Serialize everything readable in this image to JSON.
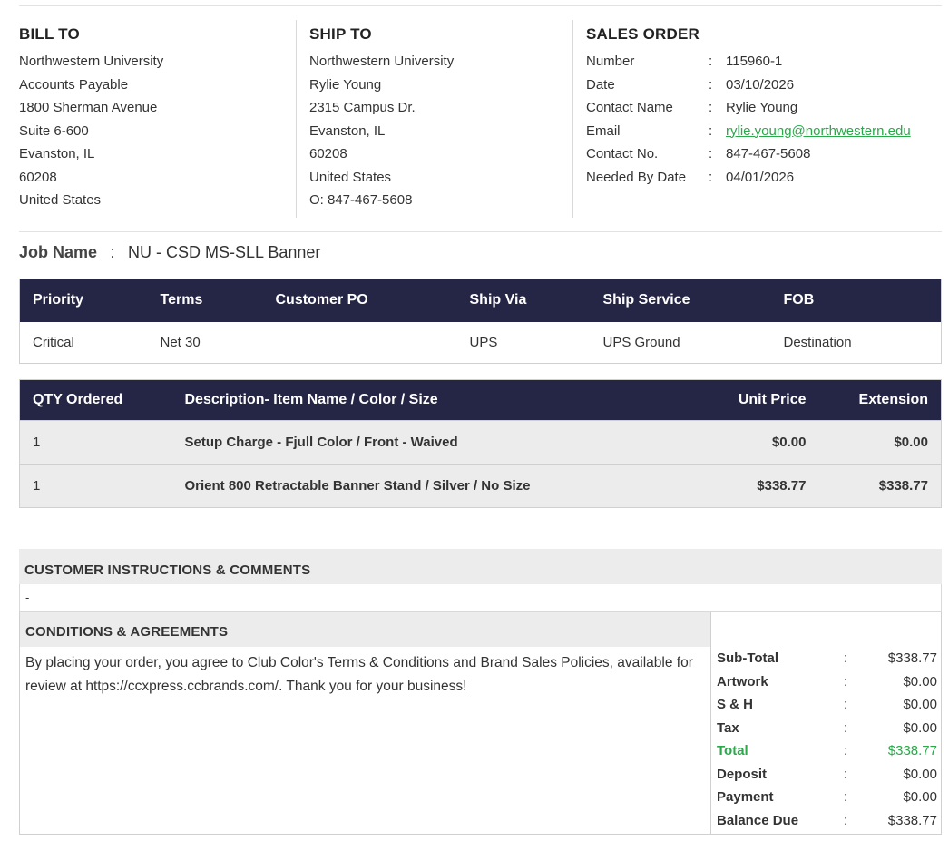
{
  "bill_to": {
    "heading": "BILL TO",
    "lines": [
      "Northwestern University",
      "Accounts Payable",
      "1800 Sherman Avenue",
      "Suite 6-600",
      "Evanston, IL",
      "60208",
      "United States"
    ]
  },
  "ship_to": {
    "heading": "SHIP TO",
    "lines": [
      "Northwestern University",
      "Rylie Young",
      "2315 Campus Dr.",
      "Evanston, IL",
      "60208",
      "United States",
      "O: 847-467-5608"
    ]
  },
  "sales_order": {
    "heading": "SALES ORDER",
    "rows": [
      {
        "label": "Number",
        "value": "115960-1"
      },
      {
        "label": "Date",
        "value": "03/10/2026"
      },
      {
        "label": "Contact Name",
        "value": "Rylie Young"
      },
      {
        "label": "Email",
        "value": "rylie.young@northwestern.edu"
      },
      {
        "label": "Contact No.",
        "value": "847-467-5608"
      },
      {
        "label": "Needed By Date",
        "value": "04/01/2026"
      }
    ]
  },
  "job": {
    "label": "Job Name",
    "value": "NU - CSD MS-SLL Banner"
  },
  "info_table": {
    "headers": [
      "Priority",
      "Terms",
      "Customer PO",
      "Ship Via",
      "Ship Service",
      "FOB"
    ],
    "row": [
      "Critical",
      "Net 30",
      "",
      "UPS",
      "UPS Ground",
      "Destination"
    ]
  },
  "items_table": {
    "headers": [
      "QTY Ordered",
      "Description- Item Name / Color / Size",
      "Unit Price",
      "Extension"
    ],
    "rows": [
      [
        "1",
        "Setup Charge - Fjull Color / Front - Waived",
        "$0.00",
        "$0.00"
      ],
      [
        "1",
        "Orient 800 Retractable Banner Stand / Silver / No Size",
        "$338.77",
        "$338.77"
      ]
    ]
  },
  "customer_instructions": {
    "heading": "CUSTOMER INSTRUCTIONS & COMMENTS",
    "text": "-"
  },
  "conditions": {
    "heading": "CONDITIONS & AGREEMENTS",
    "text": "By placing your order, you agree to Club Color's Terms & Conditions and Brand Sales Policies, available for review at https://ccxpress.ccbrands.com/. Thank you for your business!"
  },
  "totals": [
    {
      "label": "Sub-Total",
      "value": "$338.77"
    },
    {
      "label": "Artwork",
      "value": "$0.00"
    },
    {
      "label": "S & H",
      "value": "$0.00"
    },
    {
      "label": "Tax",
      "value": "$0.00"
    },
    {
      "label": "Total",
      "value": "$338.77"
    },
    {
      "label": "Deposit",
      "value": "$0.00"
    },
    {
      "label": "Payment",
      "value": "$0.00"
    },
    {
      "label": "Balance Due",
      "value": "$338.77"
    }
  ],
  "colors": {
    "header_bg": "#252545",
    "accent_green": "#2aa84a",
    "row_bg": "#ececec"
  }
}
